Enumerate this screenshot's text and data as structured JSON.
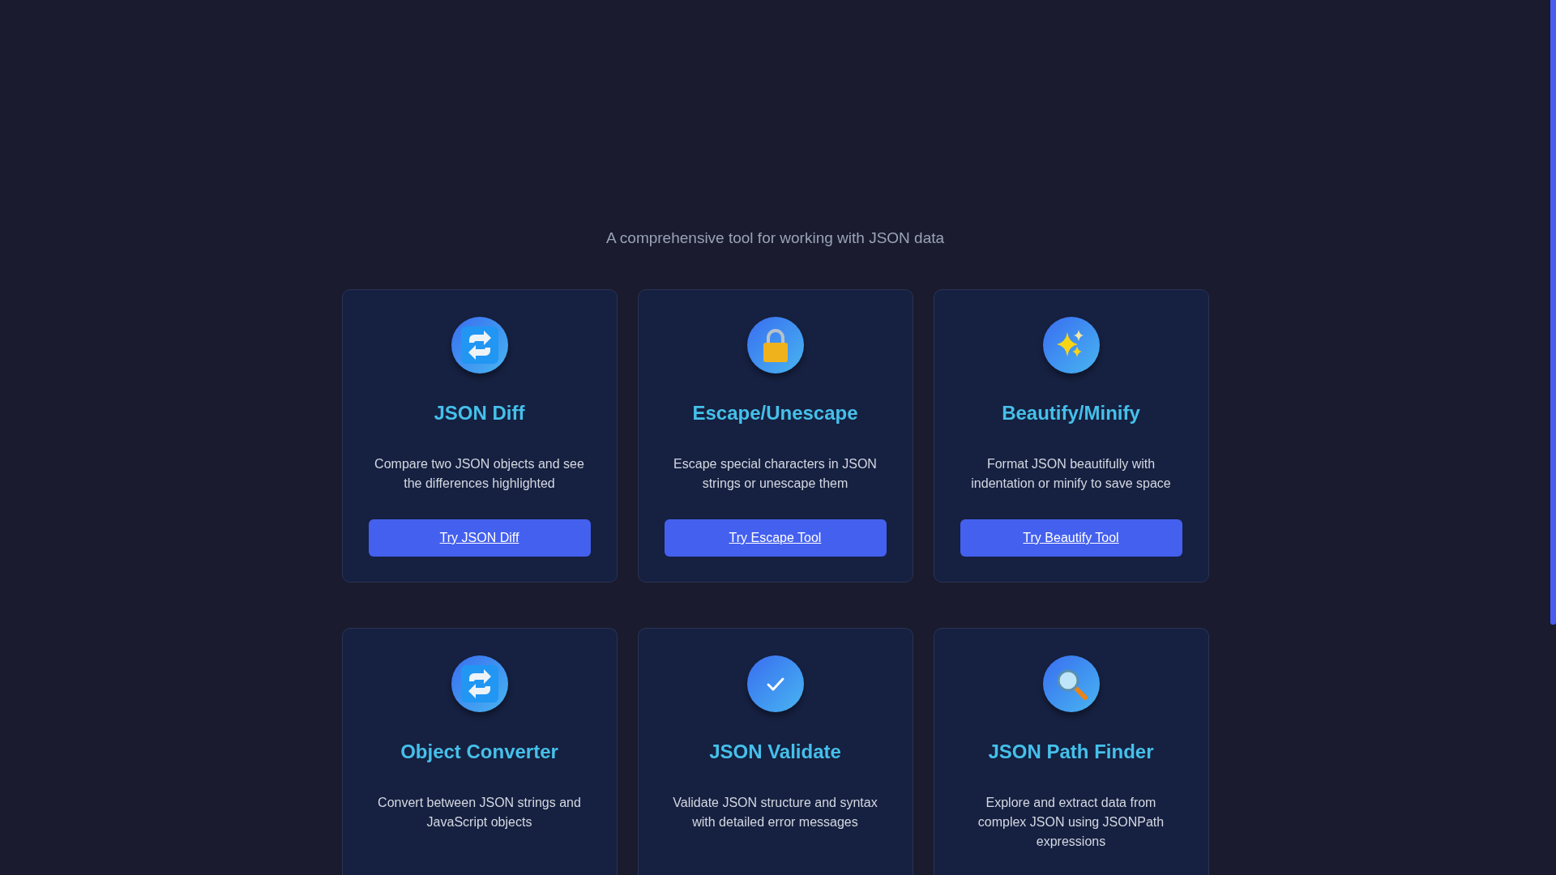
{
  "subtitle": "A comprehensive tool for working with JSON data",
  "tools": [
    {
      "kind": "repeat",
      "title": "JSON Diff",
      "description": "Compare two JSON objects and see the differences highlighted",
      "button": "Try JSON Diff"
    },
    {
      "kind": "lock",
      "title": "Escape/Unescape",
      "description": "Escape special characters in JSON strings or unescape them",
      "button": "Try Escape Tool"
    },
    {
      "kind": "sparkles",
      "title": "Beautify/Minify",
      "description": "Format JSON beautifully with indentation or minify to save space",
      "button": "Try Beautify Tool"
    },
    {
      "kind": "repeat",
      "title": "Object Converter",
      "description": "Convert between JSON strings and JavaScript objects"
    },
    {
      "kind": "check",
      "title": "JSON Validate",
      "description": "Validate JSON structure and syntax with detailed error messages"
    },
    {
      "kind": "search",
      "title": "JSON Path Finder",
      "description": "Explore and extract data from complex JSON using JSONPath expressions"
    }
  ]
}
